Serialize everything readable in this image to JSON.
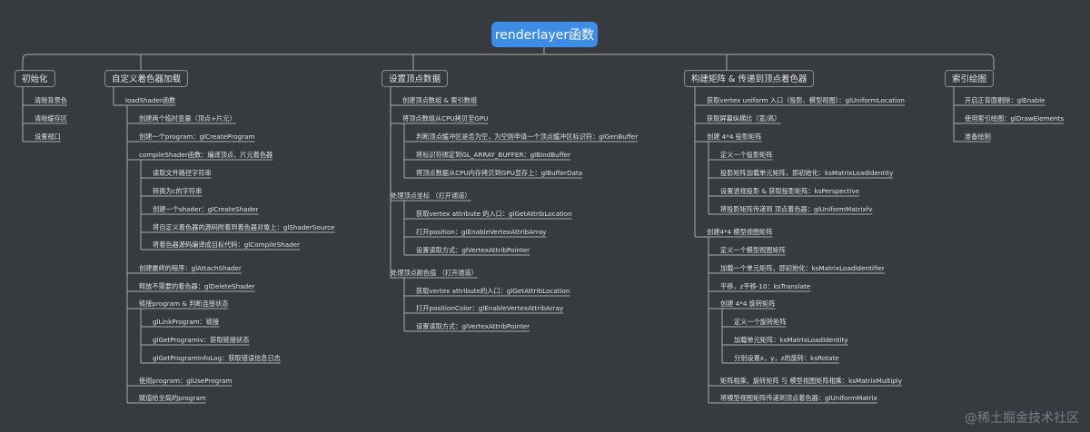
{
  "root": "renderlayer函数",
  "branches": [
    {
      "id": "init",
      "label": "初始化",
      "children": [
        {
          "id": "init_1",
          "label": "清除背景色"
        },
        {
          "id": "init_2",
          "label": "清除缓存区"
        },
        {
          "id": "init_3",
          "label": "设置视口"
        }
      ]
    },
    {
      "id": "shader",
      "label": "自定义着色器加载",
      "children": [
        {
          "id": "sh_a",
          "label": "loadShader函数",
          "children": [
            {
              "id": "sh_a1",
              "label": "创建两个临时变量（顶点+片元）"
            },
            {
              "id": "sh_a2",
              "label": "创建一个program：glCreateProgram"
            },
            {
              "id": "sh_a3",
              "label": "compileShader函数：编译顶点、片元着色器",
              "children": [
                {
                  "id": "sh_a3_1",
                  "label": "读取文件路径字符串"
                },
                {
                  "id": "sh_a3_2",
                  "label": "转换为c的字符串"
                },
                {
                  "id": "sh_a3_3",
                  "label": "创建一个shader：glCreateShader"
                },
                {
                  "id": "sh_a3_4",
                  "label": "将自定义着色器的源码附着到着色器对象上：glShaderSource"
                },
                {
                  "id": "sh_a3_5",
                  "label": "将着色器源码编译成目标代码：glCompileShader"
                }
              ]
            },
            {
              "id": "sh_a4",
              "label": "创建最终的程序：glAttachShader"
            },
            {
              "id": "sh_a5",
              "label": "释放不需要的着色器：glDeleteShader"
            }
          ]
        },
        {
          "id": "sh_b",
          "label": "链接program & 判断连接状态",
          "children": [
            {
              "id": "sh_b1",
              "label": "glLinkProgram：链接"
            },
            {
              "id": "sh_b2",
              "label": "glGetProgramiv：获取链接状态"
            },
            {
              "id": "sh_b3",
              "label": "glGetProgramInfoLog：获取错误信息日志"
            }
          ]
        },
        {
          "id": "sh_c",
          "label": "使用program：glUseProgram"
        },
        {
          "id": "sh_d",
          "label": "赋值给全局的program"
        }
      ]
    },
    {
      "id": "vertex",
      "label": "设置顶点数据",
      "children": [
        {
          "id": "vx_a",
          "label": "创建顶点数组 & 索引数组"
        },
        {
          "id": "vx_b",
          "label": "将顶点数组从CPU拷贝至GPU",
          "children": [
            {
              "id": "vx_b1",
              "label": "判断顶点缓冲区是否为空，为空则申请一个顶点缓冲区标识符：glGenBuffer"
            },
            {
              "id": "vx_b2",
              "label": "将标识符绑定到GL_ARRAY_BUFFER：glBindBuffer"
            },
            {
              "id": "vx_b3",
              "label": "将顶点数据从CPU内存拷贝到GPU显存上：glBufferData"
            }
          ]
        },
        {
          "id": "vx_c",
          "label": "处理顶点坐标 （打开通道）",
          "children": [
            {
              "id": "vx_c1",
              "label": "获取vertex attribute 的入口：glGetAttribLocation"
            },
            {
              "id": "vx_c2",
              "label": "打开position：glEnableVertexAttribArray"
            },
            {
              "id": "vx_c3",
              "label": "设置读取方式：glVertexAttribPointer"
            }
          ]
        },
        {
          "id": "vx_d",
          "label": "处理顶点颜色值 （打开通道）",
          "children": [
            {
              "id": "vx_d1",
              "label": "获取vertex attribute的入口：glGetAttribLocation"
            },
            {
              "id": "vx_d2",
              "label": "打开positionColor：glEnableVertexAttribArray"
            },
            {
              "id": "vx_d3",
              "label": "设置读取方式：glVertexAttribPointer"
            }
          ]
        }
      ]
    },
    {
      "id": "matrix",
      "label": "构建矩阵 & 传递到顶点着色器",
      "children": [
        {
          "id": "mx_a",
          "label": "获取vertex uniform 入口（投影、模型视图）：glUniformLocation"
        },
        {
          "id": "mx_b",
          "label": "获取屏幕纵横比（宽/高）"
        },
        {
          "id": "mx_c",
          "label": "创建 4*4 投影矩阵",
          "children": [
            {
              "id": "mx_c1",
              "label": "定义一个投影矩阵"
            },
            {
              "id": "mx_c2",
              "label": "投影矩阵加载单元矩阵，即初始化：ksMatrixLoadIdentity"
            },
            {
              "id": "mx_c3",
              "label": "设置透视投影 & 获取投影矩阵：ksPerspective"
            },
            {
              "id": "mx_c4",
              "label": "将投影矩阵传递到 顶点着色器：glUniformMatrixfv"
            }
          ]
        },
        {
          "id": "mx_d",
          "label": "创建4*4 模型视图矩阵",
          "children": [
            {
              "id": "mx_d1",
              "label": "定义一个模型视图矩阵"
            },
            {
              "id": "mx_d2",
              "label": "加载一个单元矩阵，即初始化：ksMatrixLoadIdentifier"
            },
            {
              "id": "mx_d3",
              "label": "平移，z平移-10：ksTranslate"
            },
            {
              "id": "mx_d4",
              "label": "创建 4*4 旋转矩阵",
              "children": [
                {
                  "id": "mx_d4_1",
                  "label": "定义一个旋转矩阵"
                },
                {
                  "id": "mx_d4_2",
                  "label": "加载单元矩阵：ksMatrixLoadIdentity"
                },
                {
                  "id": "mx_d4_3",
                  "label": "分别设置x，y，z的旋转：ksRotate"
                }
              ]
            },
            {
              "id": "mx_d5",
              "label": "矩阵相乘，旋转矩阵 与 模型视图矩阵相乘：ksMatrixMultiply"
            },
            {
              "id": "mx_d6",
              "label": "将模型视图矩阵传递到顶点着色器：glUniformMatrix"
            }
          ]
        }
      ]
    },
    {
      "id": "draw",
      "label": "索引绘图",
      "children": [
        {
          "id": "dr_1",
          "label": "开启正背面剔除：glEnable"
        },
        {
          "id": "dr_2",
          "label": "使用索引绘图：glDrawElements"
        },
        {
          "id": "dr_3",
          "label": "准备绘制"
        }
      ]
    }
  ],
  "watermark": "@稀土掘金技术社区",
  "colors": {
    "background": "#373a3f",
    "root": "#3d8de6",
    "line": "#a9adb3",
    "text": "#e0e2e5"
  }
}
